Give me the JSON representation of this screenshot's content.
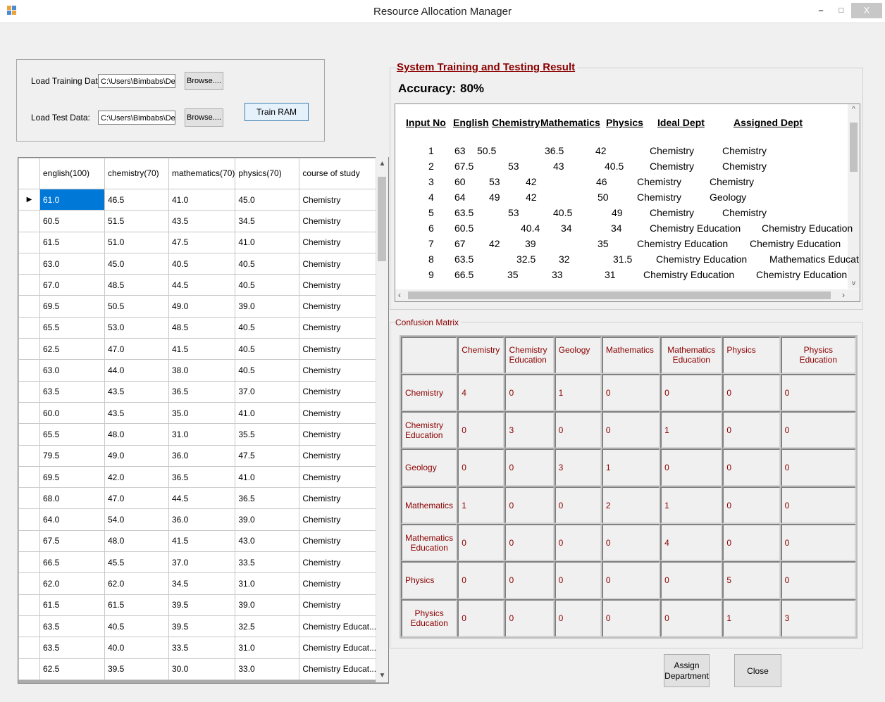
{
  "window": {
    "title": "Resource Allocation Manager",
    "minimize": "–",
    "restore": "□",
    "close": "X"
  },
  "load": {
    "training_label": "Load Training Data:",
    "training_path": "C:\\Users\\Bimbabs\\Desk",
    "test_label": "Load Test Data:",
    "test_path": "C:\\Users\\Bimbabs\\Desk",
    "browse_label": "Browse....",
    "train_label": "Train RAM"
  },
  "grid": {
    "columns": [
      "english(100)",
      "chemistry(70)",
      "mathematics(70)",
      "physics(70)",
      "course of study"
    ],
    "rows": [
      [
        "61.0",
        "46.5",
        "41.0",
        "45.0",
        "Chemistry"
      ],
      [
        "60.5",
        "51.5",
        "43.5",
        "34.5",
        "Chemistry"
      ],
      [
        "61.5",
        "51.0",
        "47.5",
        "41.0",
        "Chemistry"
      ],
      [
        "63.0",
        "45.0",
        "40.5",
        "40.5",
        "Chemistry"
      ],
      [
        "67.0",
        "48.5",
        "44.5",
        "40.5",
        "Chemistry"
      ],
      [
        "69.5",
        "50.5",
        "49.0",
        "39.0",
        "Chemistry"
      ],
      [
        "65.5",
        "53.0",
        "48.5",
        "40.5",
        "Chemistry"
      ],
      [
        "62.5",
        "47.0",
        "41.5",
        "40.5",
        "Chemistry"
      ],
      [
        "63.0",
        "44.0",
        "38.0",
        "40.5",
        "Chemistry"
      ],
      [
        "63.5",
        "43.5",
        "36.5",
        "37.0",
        "Chemistry"
      ],
      [
        "60.0",
        "43.5",
        "35.0",
        "41.0",
        "Chemistry"
      ],
      [
        "65.5",
        "48.0",
        "31.0",
        "35.5",
        "Chemistry"
      ],
      [
        "79.5",
        "49.0",
        "36.0",
        "47.5",
        "Chemistry"
      ],
      [
        "69.5",
        "42.0",
        "36.5",
        "41.0",
        "Chemistry"
      ],
      [
        "68.0",
        "47.0",
        "44.5",
        "36.5",
        "Chemistry"
      ],
      [
        "64.0",
        "54.0",
        "36.0",
        "39.0",
        "Chemistry"
      ],
      [
        "67.5",
        "48.0",
        "41.5",
        "43.0",
        "Chemistry"
      ],
      [
        "66.5",
        "45.5",
        "37.0",
        "33.5",
        "Chemistry"
      ],
      [
        "62.0",
        "62.0",
        "34.5",
        "31.0",
        "Chemistry"
      ],
      [
        "61.5",
        "61.5",
        "39.5",
        "39.0",
        "Chemistry"
      ],
      [
        "63.5",
        "40.5",
        "39.5",
        "32.5",
        "Chemistry Educat..."
      ],
      [
        "63.5",
        "40.0",
        "33.5",
        "31.0",
        "Chemistry Educat..."
      ],
      [
        "62.5",
        "39.5",
        "30.0",
        "33.0",
        "Chemistry Educat..."
      ]
    ]
  },
  "results": {
    "title": "System Training and Testing Result",
    "accuracy_label": "Accuracy:",
    "accuracy_value": "80%",
    "headers": [
      "Input No",
      "English",
      "Chemistry",
      "Mathematics",
      "Physics",
      "Ideal Dept",
      "Assigned Dept"
    ],
    "rows": [
      [
        "1",
        "63",
        "50.5",
        "36.5",
        "42",
        "Chemistry",
        "Chemistry"
      ],
      [
        "2",
        "67.5",
        "53",
        "43",
        "40.5",
        "Chemistry",
        "Chemistry"
      ],
      [
        "3",
        "60",
        "53",
        "42",
        "46",
        "Chemistry",
        "Chemistry"
      ],
      [
        "4",
        "64",
        "49",
        "42",
        "50",
        "Chemistry",
        "Geology"
      ],
      [
        "5",
        "63.5",
        "53",
        "40.5",
        "49",
        "Chemistry",
        "Chemistry"
      ],
      [
        "6",
        "60.5",
        "40.4",
        "34",
        "34",
        "Chemistry Education",
        "Chemistry Education"
      ],
      [
        "7",
        "67",
        "42",
        "39",
        "35",
        "Chemistry Education",
        "Chemistry Education"
      ],
      [
        "8",
        "63.5",
        "32.5",
        "32",
        "31.5",
        "Chemistry Education",
        "Mathematics Educat"
      ],
      [
        "9",
        "66.5",
        "35",
        "33",
        "31",
        "Chemistry Education",
        "Chemistry Education"
      ]
    ]
  },
  "confusion": {
    "title": "Confusion Matrix",
    "classes": [
      "Chemistry",
      "Chemistry Education",
      "Geology",
      "Mathematics",
      "Mathematics Education",
      "Physics",
      "Physics Education"
    ],
    "matrix": [
      [
        "4",
        "0",
        "1",
        "0",
        "0",
        "0",
        "0"
      ],
      [
        "0",
        "3",
        "0",
        "0",
        "1",
        "0",
        "0"
      ],
      [
        "0",
        "0",
        "3",
        "1",
        "0",
        "0",
        "0"
      ],
      [
        "1",
        "0",
        "0",
        "2",
        "1",
        "0",
        "0"
      ],
      [
        "0",
        "0",
        "0",
        "0",
        "4",
        "0",
        "0"
      ],
      [
        "0",
        "0",
        "0",
        "0",
        "0",
        "5",
        "0"
      ],
      [
        "0",
        "0",
        "0",
        "0",
        "0",
        "1",
        "3"
      ]
    ]
  },
  "actions": {
    "assign_label": "Assign Department",
    "close_label": "Close"
  }
}
